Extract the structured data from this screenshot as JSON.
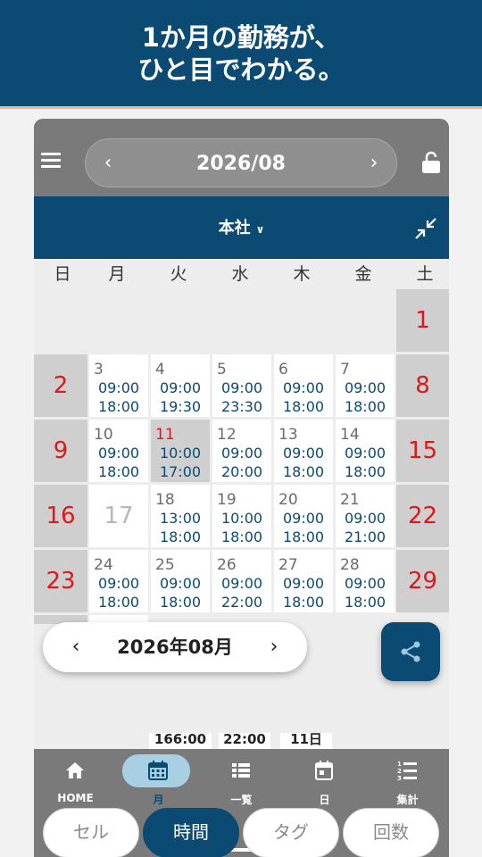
{
  "banner": {
    "line1": "1か月の勤務が、",
    "line2": "ひと目でわかる。"
  },
  "topbar": {
    "month_label": "2026/08",
    "prev": "‹",
    "next": "›"
  },
  "subbar": {
    "office": "本社",
    "chevron": "⌄"
  },
  "weekdays": [
    "日",
    "月",
    "火",
    "水",
    "木",
    "金",
    "土"
  ],
  "calendar": {
    "sat1": "1",
    "row1": {
      "sun": "2",
      "sat": "8",
      "days": [
        {
          "d": "3",
          "t1": "09:00",
          "t2": "18:00"
        },
        {
          "d": "4",
          "t1": "09:00",
          "t2": "19:30"
        },
        {
          "d": "5",
          "t1": "09:00",
          "t2": "23:30"
        },
        {
          "d": "6",
          "t1": "09:00",
          "t2": "18:00"
        },
        {
          "d": "7",
          "t1": "09:00",
          "t2": "18:00"
        }
      ]
    },
    "row2": {
      "sun": "9",
      "sat": "15",
      "days": [
        {
          "d": "10",
          "t1": "09:00",
          "t2": "18:00"
        },
        {
          "d": "11",
          "t1": "10:00",
          "t2": "17:00"
        },
        {
          "d": "12",
          "t1": "09:00",
          "t2": "20:00"
        },
        {
          "d": "13",
          "t1": "09:00",
          "t2": "18:00"
        },
        {
          "d": "14",
          "t1": "09:00",
          "t2": "18:00"
        }
      ]
    },
    "row3": {
      "sun": "16",
      "sat": "22",
      "mon": "17",
      "days": [
        {
          "d": "18",
          "t1": "13:00",
          "t2": "18:00"
        },
        {
          "d": "19",
          "t1": "10:00",
          "t2": "18:00"
        },
        {
          "d": "20",
          "t1": "09:00",
          "t2": "18:00"
        },
        {
          "d": "21",
          "t1": "09:00",
          "t2": "21:00"
        }
      ]
    },
    "row4": {
      "sun": "23",
      "sat": "29",
      "days": [
        {
          "d": "24",
          "t1": "09:00",
          "t2": "18:00"
        },
        {
          "d": "25",
          "t1": "09:00",
          "t2": "18:00"
        },
        {
          "d": "26",
          "t1": "09:00",
          "t2": "22:00"
        },
        {
          "d": "27",
          "t1": "09:00",
          "t2": "18:00"
        },
        {
          "d": "28",
          "t1": "09:00",
          "t2": "18:00"
        }
      ]
    }
  },
  "summary": {
    "total_hours": "166:00",
    "late": "22:00",
    "days": "11日"
  },
  "month_selector": {
    "label": "2026年08月",
    "prev": "‹",
    "next": "›"
  },
  "segments": [
    "セル",
    "時間",
    "タグ",
    "回数"
  ],
  "nav": [
    {
      "label": "HOME",
      "icon": "home-icon"
    },
    {
      "label": "月",
      "icon": "calendar-month-icon"
    },
    {
      "label": "一覧",
      "icon": "list-icon"
    },
    {
      "label": "日",
      "icon": "calendar-day-icon"
    },
    {
      "label": "集計",
      "icon": "numbered-list-icon"
    }
  ],
  "colors": {
    "primary": "#0b4a73",
    "holiday": "#e0161a",
    "toolbar": "#7a7a7a",
    "accent_line": "#f0b98f"
  }
}
